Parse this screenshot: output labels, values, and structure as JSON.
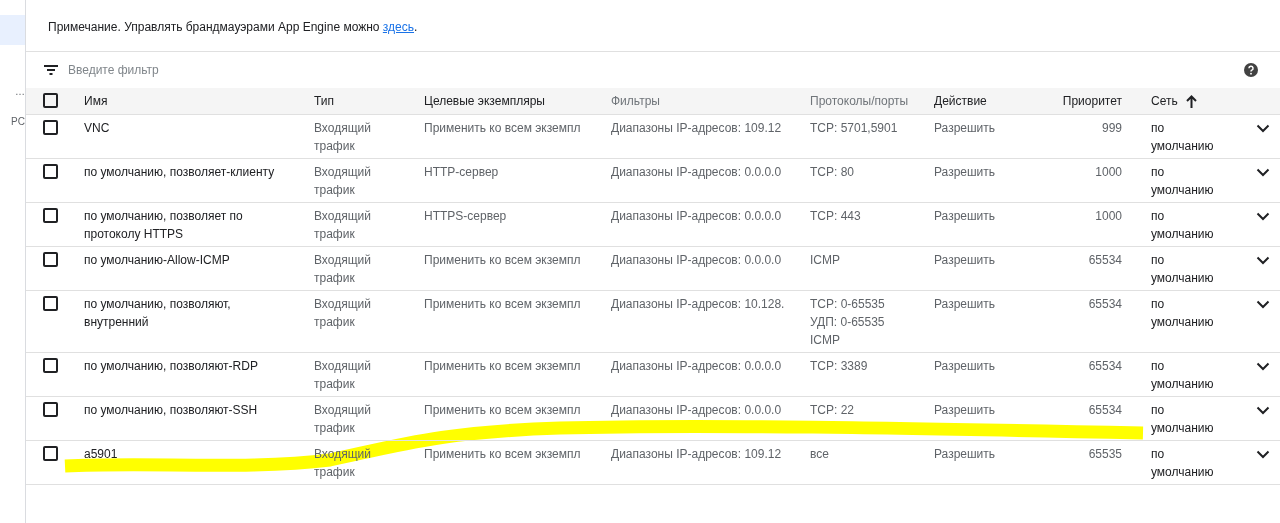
{
  "sidebar": {
    "items": [
      {
        "selected": true
      },
      {
        "label": "…",
        "selected": false
      },
      {
        "label": "PC",
        "selected": false
      }
    ]
  },
  "note": {
    "text": "Примечание. Управлять брандмауэрами App Engine можно",
    "link": "здесь",
    "after": "."
  },
  "filter": {
    "placeholder": "Введите фильтр"
  },
  "table": {
    "columns": [
      {
        "label": "Имя",
        "dimmed": false,
        "sorted": false
      },
      {
        "label": "Тип",
        "dimmed": false,
        "sorted": false
      },
      {
        "label": "Целевые экземпляры",
        "dimmed": false,
        "sorted": false
      },
      {
        "label": "Фильтры",
        "dimmed": true,
        "sorted": false
      },
      {
        "label": "Протоколы/порты",
        "dimmed": true,
        "sorted": false
      },
      {
        "label": "Действие",
        "dimmed": false,
        "sorted": false
      },
      {
        "label": "Приоритет",
        "dimmed": false,
        "sorted": false
      },
      {
        "label": "Сеть",
        "dimmed": false,
        "sorted": true
      }
    ],
    "all_checked": false,
    "rows": [
      {
        "checked": false,
        "name": "VNC",
        "type": "Входящий трафик",
        "targets": "Применить ко всем экземпл",
        "filters": "Диапазоны IP-адресов: 109.12",
        "protocols": [
          "TCP: 5701,5901"
        ],
        "action": "Разрешить",
        "priority": "999",
        "network": "по умолчанию"
      },
      {
        "checked": false,
        "name": "по умолчанию, позволяет-клиенту",
        "type": "Входящий трафик",
        "targets": "HTTP-сервер",
        "filters": "Диапазоны IP-адресов: 0.0.0.0",
        "protocols": [
          "TCP: 80"
        ],
        "action": "Разрешить",
        "priority": "1000",
        "network": "по умолчанию"
      },
      {
        "checked": false,
        "name": "по умолчанию, позволяет по протоколу HTTPS",
        "type": "Входящий трафик",
        "targets": "HTTPS-сервер",
        "filters": "Диапазоны IP-адресов: 0.0.0.0",
        "protocols": [
          "TCP: 443"
        ],
        "action": "Разрешить",
        "priority": "1000",
        "network": "по умолчанию"
      },
      {
        "checked": false,
        "name": "по умолчанию-Allow-ICMP",
        "type": "Входящий трафик",
        "targets": "Применить ко всем экземпл",
        "filters": "Диапазоны IP-адресов: 0.0.0.0",
        "protocols": [
          "ICMP"
        ],
        "action": "Разрешить",
        "priority": "65534",
        "network": "по умолчанию"
      },
      {
        "checked": false,
        "name": "по умолчанию, позволяют, внутренний",
        "type": "Входящий трафик",
        "targets": "Применить ко всем экземпл",
        "filters": "Диапазоны IP-адресов: 10.128.",
        "protocols": [
          "TCP: 0-65535",
          "УДП: 0-65535",
          "ICMP"
        ],
        "action": "Разрешить",
        "priority": "65534",
        "network": "по умолчанию"
      },
      {
        "checked": false,
        "name": "по умолчанию, позволяют-RDP",
        "type": "Входящий трафик",
        "targets": "Применить ко всем экземпл",
        "filters": "Диапазоны IP-адресов: 0.0.0.0",
        "protocols": [
          "TCP: 3389"
        ],
        "action": "Разрешить",
        "priority": "65534",
        "network": "по умолчанию"
      },
      {
        "checked": false,
        "name": "по умолчанию, позволяют-SSH",
        "type": "Входящий трафик",
        "targets": "Применить ко всем экземпл",
        "filters": "Диапазоны IP-адресов: 0.0.0.0",
        "protocols": [
          "TCP: 22"
        ],
        "action": "Разрешить",
        "priority": "65534",
        "network": "по умолчанию"
      },
      {
        "checked": false,
        "name": "a5901",
        "type": "Входящий трафик",
        "targets": "Применить ко всем экземпл",
        "filters": "Диапазоны IP-адресов: 109.12",
        "protocols": [
          "все"
        ],
        "action": "Разрешить",
        "priority": "65535",
        "network": "по умолчанию"
      }
    ]
  }
}
